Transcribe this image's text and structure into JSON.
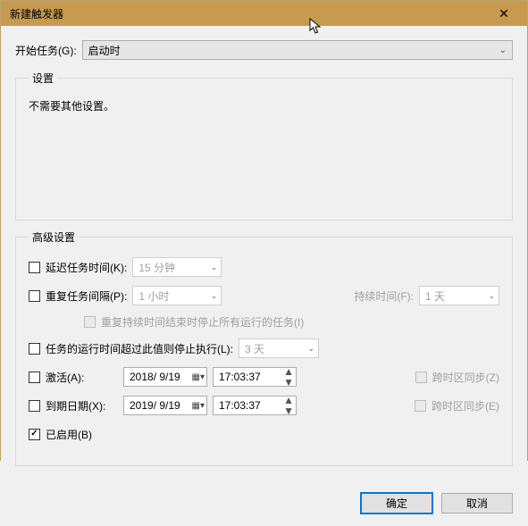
{
  "window": {
    "title": "新建触发器",
    "close": "✕"
  },
  "begin": {
    "label": "开始任务(G):",
    "value": "启动时"
  },
  "settings": {
    "legend": "设置",
    "text": "不需要其他设置。"
  },
  "advanced": {
    "legend": "高级设置",
    "delay": {
      "label": "延迟任务时间(K):",
      "value": "15 分钟"
    },
    "repeat": {
      "label": "重复任务间隔(P):",
      "value": "1 小时"
    },
    "persist": {
      "label": "持续时间(F):",
      "value": "1 天"
    },
    "stop_repeated": "重复持续时间结束时停止所有运行的任务(I)",
    "stop_after": {
      "label": "任务的运行时间超过此值则停止执行(L):",
      "value": "3 天"
    },
    "activate": {
      "label": "激活(A):",
      "date": "2018/ 9/19",
      "time": "17:03:37"
    },
    "cross_tz_z": "跨时区同步(Z)",
    "expire": {
      "label": "到期日期(X):",
      "date": "2019/ 9/19",
      "time": "17:03:37"
    },
    "cross_tz_e": "跨时区同步(E)",
    "enabled": "已启用(B)"
  },
  "buttons": {
    "ok": "确定",
    "cancel": "取消"
  }
}
